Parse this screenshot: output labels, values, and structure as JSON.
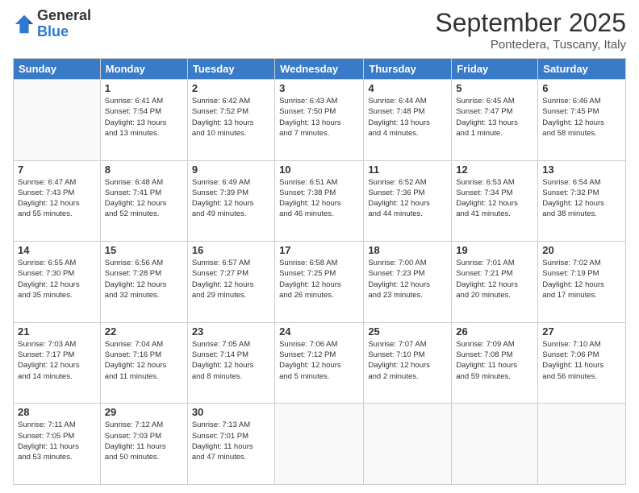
{
  "logo": {
    "general": "General",
    "blue": "Blue"
  },
  "title": "September 2025",
  "location": "Pontedera, Tuscany, Italy",
  "days_header": [
    "Sunday",
    "Monday",
    "Tuesday",
    "Wednesday",
    "Thursday",
    "Friday",
    "Saturday"
  ],
  "weeks": [
    [
      {
        "num": "",
        "info": ""
      },
      {
        "num": "1",
        "info": "Sunrise: 6:41 AM\nSunset: 7:54 PM\nDaylight: 13 hours\nand 13 minutes."
      },
      {
        "num": "2",
        "info": "Sunrise: 6:42 AM\nSunset: 7:52 PM\nDaylight: 13 hours\nand 10 minutes."
      },
      {
        "num": "3",
        "info": "Sunrise: 6:43 AM\nSunset: 7:50 PM\nDaylight: 13 hours\nand 7 minutes."
      },
      {
        "num": "4",
        "info": "Sunrise: 6:44 AM\nSunset: 7:48 PM\nDaylight: 13 hours\nand 4 minutes."
      },
      {
        "num": "5",
        "info": "Sunrise: 6:45 AM\nSunset: 7:47 PM\nDaylight: 13 hours\nand 1 minute."
      },
      {
        "num": "6",
        "info": "Sunrise: 6:46 AM\nSunset: 7:45 PM\nDaylight: 12 hours\nand 58 minutes."
      }
    ],
    [
      {
        "num": "7",
        "info": "Sunrise: 6:47 AM\nSunset: 7:43 PM\nDaylight: 12 hours\nand 55 minutes."
      },
      {
        "num": "8",
        "info": "Sunrise: 6:48 AM\nSunset: 7:41 PM\nDaylight: 12 hours\nand 52 minutes."
      },
      {
        "num": "9",
        "info": "Sunrise: 6:49 AM\nSunset: 7:39 PM\nDaylight: 12 hours\nand 49 minutes."
      },
      {
        "num": "10",
        "info": "Sunrise: 6:51 AM\nSunset: 7:38 PM\nDaylight: 12 hours\nand 46 minutes."
      },
      {
        "num": "11",
        "info": "Sunrise: 6:52 AM\nSunset: 7:36 PM\nDaylight: 12 hours\nand 44 minutes."
      },
      {
        "num": "12",
        "info": "Sunrise: 6:53 AM\nSunset: 7:34 PM\nDaylight: 12 hours\nand 41 minutes."
      },
      {
        "num": "13",
        "info": "Sunrise: 6:54 AM\nSunset: 7:32 PM\nDaylight: 12 hours\nand 38 minutes."
      }
    ],
    [
      {
        "num": "14",
        "info": "Sunrise: 6:55 AM\nSunset: 7:30 PM\nDaylight: 12 hours\nand 35 minutes."
      },
      {
        "num": "15",
        "info": "Sunrise: 6:56 AM\nSunset: 7:28 PM\nDaylight: 12 hours\nand 32 minutes."
      },
      {
        "num": "16",
        "info": "Sunrise: 6:57 AM\nSunset: 7:27 PM\nDaylight: 12 hours\nand 29 minutes."
      },
      {
        "num": "17",
        "info": "Sunrise: 6:58 AM\nSunset: 7:25 PM\nDaylight: 12 hours\nand 26 minutes."
      },
      {
        "num": "18",
        "info": "Sunrise: 7:00 AM\nSunset: 7:23 PM\nDaylight: 12 hours\nand 23 minutes."
      },
      {
        "num": "19",
        "info": "Sunrise: 7:01 AM\nSunset: 7:21 PM\nDaylight: 12 hours\nand 20 minutes."
      },
      {
        "num": "20",
        "info": "Sunrise: 7:02 AM\nSunset: 7:19 PM\nDaylight: 12 hours\nand 17 minutes."
      }
    ],
    [
      {
        "num": "21",
        "info": "Sunrise: 7:03 AM\nSunset: 7:17 PM\nDaylight: 12 hours\nand 14 minutes."
      },
      {
        "num": "22",
        "info": "Sunrise: 7:04 AM\nSunset: 7:16 PM\nDaylight: 12 hours\nand 11 minutes."
      },
      {
        "num": "23",
        "info": "Sunrise: 7:05 AM\nSunset: 7:14 PM\nDaylight: 12 hours\nand 8 minutes."
      },
      {
        "num": "24",
        "info": "Sunrise: 7:06 AM\nSunset: 7:12 PM\nDaylight: 12 hours\nand 5 minutes."
      },
      {
        "num": "25",
        "info": "Sunrise: 7:07 AM\nSunset: 7:10 PM\nDaylight: 12 hours\nand 2 minutes."
      },
      {
        "num": "26",
        "info": "Sunrise: 7:09 AM\nSunset: 7:08 PM\nDaylight: 11 hours\nand 59 minutes."
      },
      {
        "num": "27",
        "info": "Sunrise: 7:10 AM\nSunset: 7:06 PM\nDaylight: 11 hours\nand 56 minutes."
      }
    ],
    [
      {
        "num": "28",
        "info": "Sunrise: 7:11 AM\nSunset: 7:05 PM\nDaylight: 11 hours\nand 53 minutes."
      },
      {
        "num": "29",
        "info": "Sunrise: 7:12 AM\nSunset: 7:03 PM\nDaylight: 11 hours\nand 50 minutes."
      },
      {
        "num": "30",
        "info": "Sunrise: 7:13 AM\nSunset: 7:01 PM\nDaylight: 11 hours\nand 47 minutes."
      },
      {
        "num": "",
        "info": ""
      },
      {
        "num": "",
        "info": ""
      },
      {
        "num": "",
        "info": ""
      },
      {
        "num": "",
        "info": ""
      }
    ]
  ]
}
